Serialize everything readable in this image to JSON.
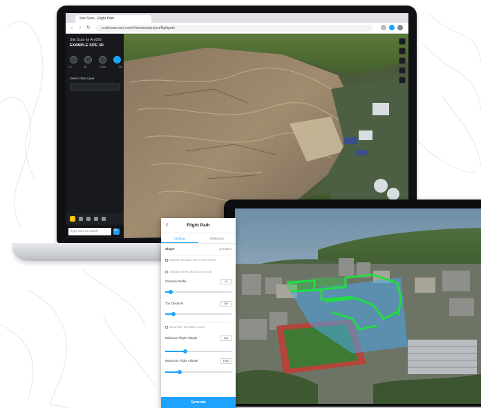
{
  "browser": {
    "tab_title": "Site Scan - Flight Path",
    "url": "a.sitescan.esri.com/#/missions/project/flightpath",
    "nav": {
      "back": "‹",
      "forward": "›",
      "reload": "↻"
    }
  },
  "laptop_app": {
    "org_label": "Site Scan for ArcGIS",
    "project_name": "EXAMPLE SITE 3D",
    "modes": [
      "2D",
      "3D",
      "Views",
      "Info"
    ],
    "layer_label": "Select Data Layer",
    "search_placeholder": "Type here to search",
    "search_button": "🔍"
  },
  "flight_panel": {
    "back_icon": "‹",
    "title": "Flight Path",
    "tabs": [
      "Settings",
      "Obstacles"
    ],
    "shape_label": "Shape",
    "shape_value": "Complex",
    "section_1": "Ignore 3D data for flightpath",
    "section_2": "Create with obstacle avoid",
    "row_1": {
      "label": "Obstacle Buffer",
      "value": "10"
    },
    "row_2": {
      "label": "Top Obstacle",
      "value": "100"
    },
    "section_3": "Relative terrain flight",
    "row_3": {
      "label": "Minimum Flight Altitude",
      "value": "120"
    },
    "row_4": {
      "label": "Maximum Flight Altitude",
      "value": "1000"
    },
    "slider_levels": [
      0.08,
      0.12,
      0.3,
      0.22
    ],
    "footer_button": "Generate"
  },
  "colors": {
    "accent": "#1fa3ff",
    "flight_path": "#22dd44",
    "area_fill": "#4aa8e8"
  }
}
